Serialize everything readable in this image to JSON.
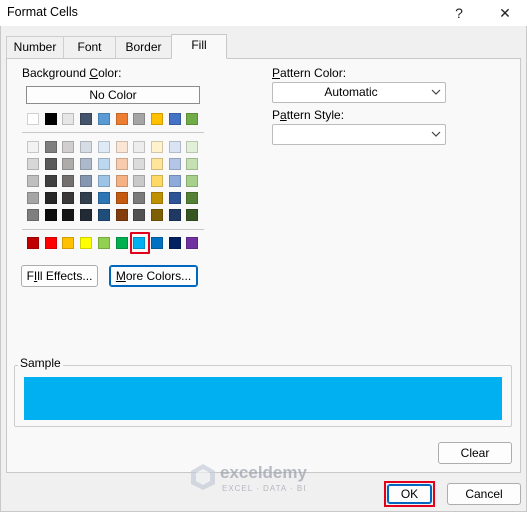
{
  "window": {
    "title": "Format Cells",
    "help_glyph": "?",
    "close_glyph": "✕"
  },
  "tabs": [
    {
      "label": "Number",
      "active": false
    },
    {
      "label": "Font",
      "active": false
    },
    {
      "label": "Border",
      "active": false
    },
    {
      "label": "Fill",
      "active": true
    }
  ],
  "fill": {
    "background_color_label_pre": "Background ",
    "background_color_label_key": "C",
    "background_color_label_post": "olor:",
    "no_color_label": "No Color",
    "pattern_color_label_key": "P",
    "pattern_color_label_post": "attern Color:",
    "pattern_color_value": "Automatic",
    "pattern_style_label_pre": "P",
    "pattern_style_label_key": "a",
    "pattern_style_label_post": "ttern Style:",
    "pattern_style_value": "",
    "fill_effects_key": "I",
    "fill_effects_pre": "F",
    "fill_effects_post": "ll Effects...",
    "more_colors_key": "M",
    "more_colors_post": "ore Colors...",
    "sample_label": "Sample",
    "sample_color": "#00b0f0",
    "selected_color": "#00b0f0"
  },
  "palette": {
    "theme_row": [
      "#ffffff",
      "#000000",
      "#e7e6e6",
      "#44546a",
      "#5b9bd5",
      "#ed7d31",
      "#a5a5a5",
      "#ffc000",
      "#4472c4",
      "#70ad47"
    ],
    "tints": [
      [
        "#f2f2f2",
        "#7f7f7f",
        "#d0cece",
        "#d6dce4",
        "#deebf6",
        "#fbe5d5",
        "#ededed",
        "#fff2cc",
        "#dae3f3",
        "#e2efd9"
      ],
      [
        "#d8d8d8",
        "#595959",
        "#aeabab",
        "#adb9ca",
        "#bdd7ee",
        "#f7cbac",
        "#dbdbdb",
        "#fee599",
        "#b4c6e7",
        "#c5e0b3"
      ],
      [
        "#bfbfbf",
        "#3f3f3f",
        "#757070",
        "#8496b0",
        "#9dc3e6",
        "#f4b183",
        "#c9c9c9",
        "#ffd965",
        "#8eaadb",
        "#a8d08d"
      ],
      [
        "#a5a5a5",
        "#262626",
        "#3a3838",
        "#323f4f",
        "#2e75b5",
        "#c55a11",
        "#7b7b7b",
        "#bf9000",
        "#2f5496",
        "#538135"
      ],
      [
        "#7f7f7f",
        "#0c0c0c",
        "#171616",
        "#222a35",
        "#1e4e79",
        "#833c0b",
        "#525252",
        "#7f6000",
        "#1f3864",
        "#375623"
      ]
    ],
    "standard_row": [
      "#c00000",
      "#ff0000",
      "#ffc000",
      "#ffff00",
      "#92d050",
      "#00b050",
      "#00b0f0",
      "#0070c0",
      "#002060",
      "#7030a0"
    ]
  },
  "footer": {
    "clear_label": "Clear",
    "ok_label": "OK",
    "cancel_label": "Cancel"
  },
  "watermark": {
    "name": "exceldemy",
    "tagline": "EXCEL · DATA · BI"
  }
}
